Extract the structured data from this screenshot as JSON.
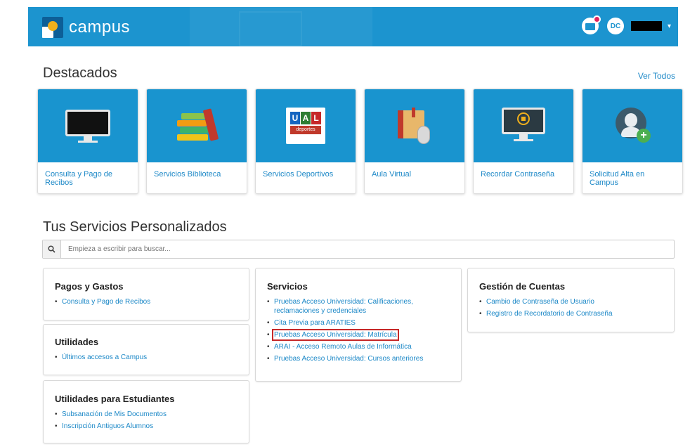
{
  "header": {
    "app_name": "campus",
    "avatar_initials": "DC",
    "message_icon": "mail-notification-icon"
  },
  "destacados": {
    "title": "Destacados",
    "ver_todos": "Ver Todos",
    "cards": [
      {
        "label": "Consulta y Pago de Recibos",
        "icon": "monitor-icon"
      },
      {
        "label": "Servicios Biblioteca",
        "icon": "books-icon"
      },
      {
        "label": "Servicios Deportivos",
        "icon": "ual-deportes-icon"
      },
      {
        "label": "Aula Virtual",
        "icon": "book-mouse-icon"
      },
      {
        "label": "Recordar Contraseña",
        "icon": "lock-monitor-icon"
      },
      {
        "label": "Solicitud Alta en Campus",
        "icon": "user-add-icon"
      }
    ],
    "ual_logo": {
      "letters": [
        "U",
        "A",
        "L"
      ],
      "subtitle": "deportes"
    }
  },
  "servicios_personalizados": {
    "title": "Tus Servicios Personalizados",
    "search_placeholder": "Empieza a escribir para buscar...",
    "panels": {
      "pagos": {
        "title": "Pagos y Gastos",
        "items": [
          "Consulta y Pago de Recibos"
        ]
      },
      "utilidades": {
        "title": "Utilidades",
        "items": [
          "Últimos accesos a Campus"
        ]
      },
      "estudiantes": {
        "title": "Utilidades para Estudiantes",
        "items": [
          "Subsanación de Mis Documentos",
          "Inscripción Antiguos Alumnos"
        ]
      },
      "servicios": {
        "title": "Servicios",
        "items": [
          "Pruebas Acceso Universidad: Calificaciones, reclamaciones y credenciales",
          "Cita Previa para ARATIES",
          "Pruebas Acceso Universidad: Matrícula",
          "ARAI - Acceso Remoto Aulas de Informática",
          "Pruebas Acceso Universidad: Cursos anteriores"
        ]
      },
      "cuentas": {
        "title": "Gestión de Cuentas",
        "items": [
          "Cambio de Contraseña de Usuario",
          "Registro de Recordatorio de Contraseña"
        ]
      }
    }
  },
  "colors": {
    "brand": "#1c94cf",
    "link": "#1c88c7",
    "highlight": "#c62828"
  }
}
